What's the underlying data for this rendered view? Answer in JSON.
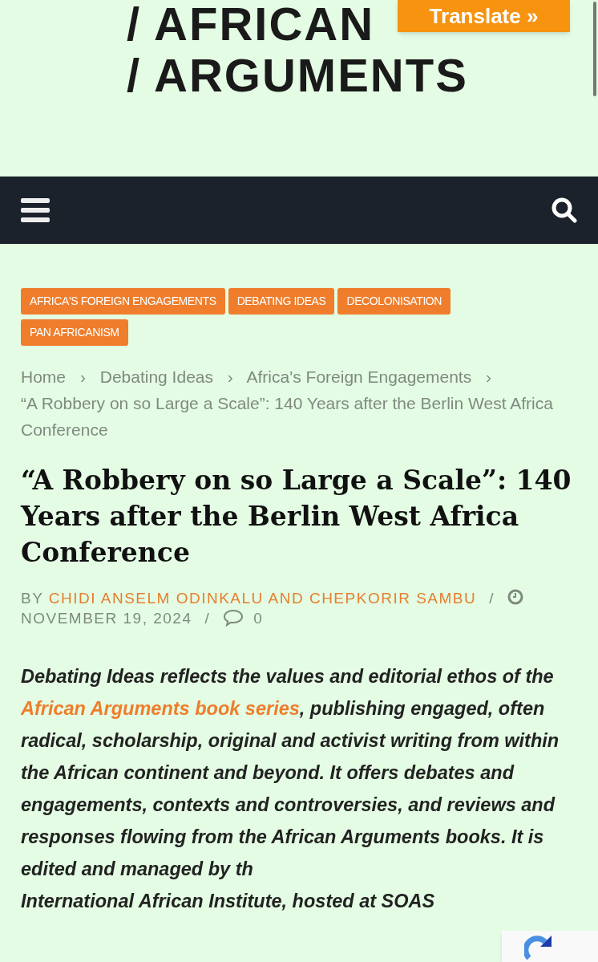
{
  "header": {
    "logo_lines": [
      "/ AFRICAN",
      "/ ARGUMENTS"
    ],
    "translate_button": "Translate »"
  },
  "tags": [
    "AFRICA'S FOREIGN ENGAGEMENTS",
    "DEBATING IDEAS",
    "DECOLONISATION",
    "PAN AFRICANISM"
  ],
  "breadcrumbs": [
    {
      "label": "Home",
      "separator": "›"
    },
    {
      "label": "Debating Ideas",
      "separator": "›"
    },
    {
      "label": "Africa's Foreign Engagements",
      "separator": "›"
    },
    {
      "label": "“A Robbery on so Large a Scale”: 140 Years after the Berlin West Africa Conference"
    }
  ],
  "title": "“A Robbery on so Large a Scale”: 140 Years after the Berlin West Africa Conference",
  "byline": {
    "prefix": "BY",
    "authors": "CHIDI ANSELM ODINKALU AND CHEPKORIR SAMBU",
    "separator": "/",
    "date": "NOVEMBER 19, 2024",
    "comments": "0"
  },
  "intro": {
    "before": "Debating Ideas reflects the values and editorial ethos of the",
    "link": "African Arguments book series",
    "after": ", publishing engaged, often radical, scholarship, original and activist writing from within the African continent and beyond. It offers debates and engagements, contexts and controversies, and reviews and responses flowing from the African Arguments books. It is edited and managed by th",
    "last_line": "International African Institute, hosted at SOAS"
  }
}
